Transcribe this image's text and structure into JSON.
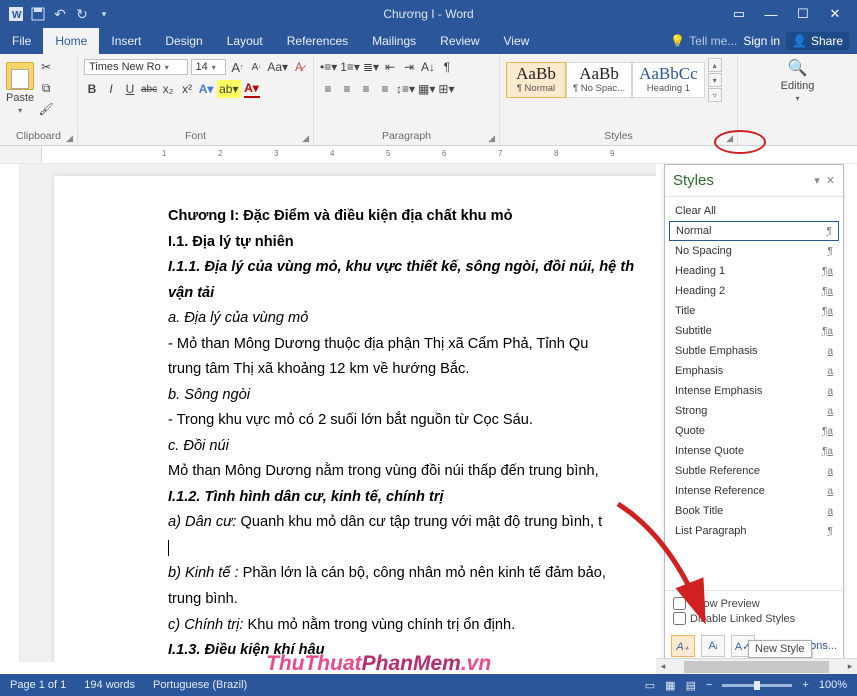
{
  "titlebar": {
    "title": "Chương I - Word"
  },
  "menutabs": [
    "File",
    "Home",
    "Insert",
    "Design",
    "Layout",
    "References",
    "Mailings",
    "Review",
    "View"
  ],
  "active_tab_index": 1,
  "tellme": "Tell me...",
  "signin": "Sign in",
  "share": "Share",
  "ribbon": {
    "clipboard": {
      "title": "Clipboard",
      "paste": "Paste"
    },
    "font": {
      "title": "Font",
      "family": "Times New Ro",
      "size": "14",
      "bold": "B",
      "italic": "I",
      "underline": "U",
      "strike": "abc",
      "sub": "x₂",
      "super": "x²",
      "grow": "A",
      "shrink": "A",
      "case": "Aa",
      "clear": "A"
    },
    "paragraph": {
      "title": "Paragraph"
    },
    "styles": {
      "title": "Styles",
      "boxes": [
        {
          "prev": "AaBb",
          "name": "¶ Normal"
        },
        {
          "prev": "AaBb",
          "name": "¶ No Spac..."
        },
        {
          "prev": "AaBbCc",
          "name": "Heading 1"
        }
      ]
    },
    "editing": {
      "title": "Editing",
      "find": "Editing"
    }
  },
  "doc": {
    "lines": [
      {
        "t": "Chương I: Đặc Điểm và điều kiện địa chất khu mỏ",
        "b": true
      },
      {
        "t": "I.1. Địa lý tự  nhiên",
        "b": true
      },
      {
        "t": "I.1.1. Địa lý của vùng mỏ, khu vực thiết kế, sông ngòi, đồi núi, hệ th",
        "b": true,
        "i": true
      },
      {
        "t": "vận tải",
        "b": true,
        "i": true
      },
      {
        "t": "a. Địa lý của vùng mỏ",
        "i": true
      },
      {
        "t": "- Mỏ than Mông Dương thuộc địa phận Thị xã Cẩm Phả, Tỉnh Qu"
      },
      {
        "t": "trung tâm Thị xã khoảng 12 km về hướng Bắc."
      },
      {
        "t": "b. Sông ngòi",
        "i": true
      },
      {
        "t": "- Trong khu vực mỏ có 2 suối lớn bắt nguồn từ Cọc Sáu."
      },
      {
        "t": "c. Đồi núi",
        "i": true
      },
      {
        "t": " Mỏ than Mông Dương nằm trong vùng đồi núi thấp đến trung bình, "
      },
      {
        "t": "I.1.2.  Tình hình dân cư, kinh tế, chính trị",
        "b": true,
        "i": true
      },
      {
        "run": [
          {
            "t": "a) Dân cư:",
            "i": true
          },
          {
            "t": "  Quanh khu mỏ dân cư tập trung với mật độ trung bình, t"
          }
        ]
      },
      {
        "cursor": true
      },
      {
        "run": [
          {
            "t": "b) Kinh tế :",
            "i": true
          },
          {
            "t": " Phần lớn là cán bộ, công nhân mỏ nên kinh tế đảm bảo, "
          }
        ]
      },
      {
        "t": "trung bình."
      },
      {
        "run": [
          {
            "t": "c) Chính trị:",
            "i": true
          },
          {
            "t": " Khu mỏ nằm trong vùng chính trị ổn định."
          }
        ]
      },
      {
        "t": "I.1.3. Điều kiện khí hậu",
        "b": true,
        "i": true
      }
    ]
  },
  "styles_pane": {
    "title": "Styles",
    "clear_all": "Clear All",
    "items": [
      {
        "n": "Normal",
        "m": "¶",
        "sel": true
      },
      {
        "n": "No Spacing",
        "m": "¶"
      },
      {
        "n": "Heading 1",
        "m": "¶a"
      },
      {
        "n": "Heading 2",
        "m": "¶a"
      },
      {
        "n": "Title",
        "m": "¶a"
      },
      {
        "n": "Subtitle",
        "m": "¶a"
      },
      {
        "n": "Subtle Emphasis",
        "m": "a"
      },
      {
        "n": "Emphasis",
        "m": "a"
      },
      {
        "n": "Intense Emphasis",
        "m": "a"
      },
      {
        "n": "Strong",
        "m": "a"
      },
      {
        "n": "Quote",
        "m": "¶a"
      },
      {
        "n": "Intense Quote",
        "m": "¶a"
      },
      {
        "n": "Subtle Reference",
        "m": "a"
      },
      {
        "n": "Intense Reference",
        "m": "a"
      },
      {
        "n": "Book Title",
        "m": "a"
      },
      {
        "n": "List Paragraph",
        "m": "¶"
      }
    ],
    "show_preview": "Show Preview",
    "disable_linked": "Disable Linked Styles",
    "options": "Options...",
    "tooltip": "New Style"
  },
  "watermark": {
    "a": "ThuThuat",
    "b": "PhanMem",
    "c": ".vn"
  },
  "status": {
    "page": "Page 1 of 1",
    "words": "194 words",
    "lang": "Portuguese (Brazil)",
    "zoom_minus": "−",
    "zoom_plus": "+",
    "zoom": "100%"
  }
}
